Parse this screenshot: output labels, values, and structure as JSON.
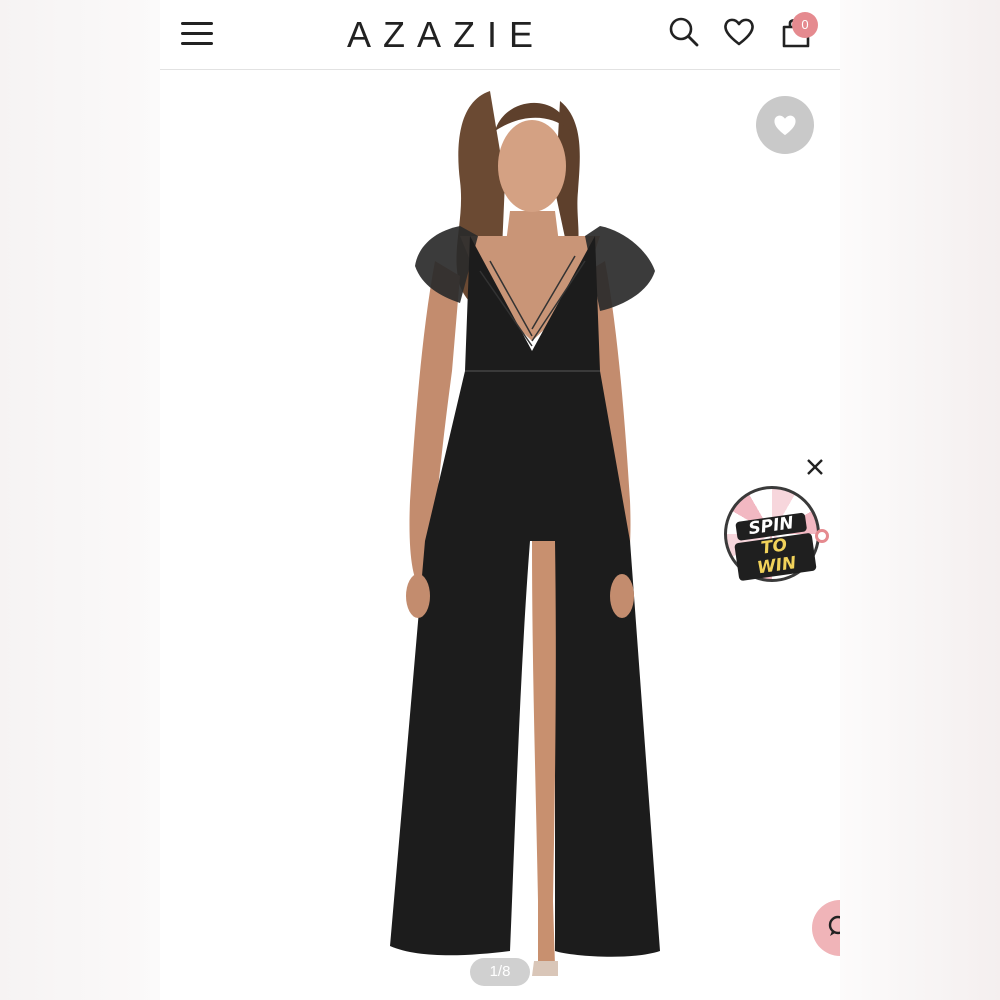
{
  "header": {
    "logo": "AZAZIE",
    "cart_count": "0",
    "icons": [
      "menu-icon",
      "search-icon",
      "heart-icon",
      "shopping-bag-icon"
    ]
  },
  "gallery": {
    "image_counter": "1/8",
    "dress_color": "#1c1c1c"
  },
  "promo": {
    "spin_line1": "SPIN",
    "spin_line2": "TO WIN"
  },
  "colors": {
    "accent_pink": "#e58a8f",
    "fav_button": "#c9c9c9"
  }
}
